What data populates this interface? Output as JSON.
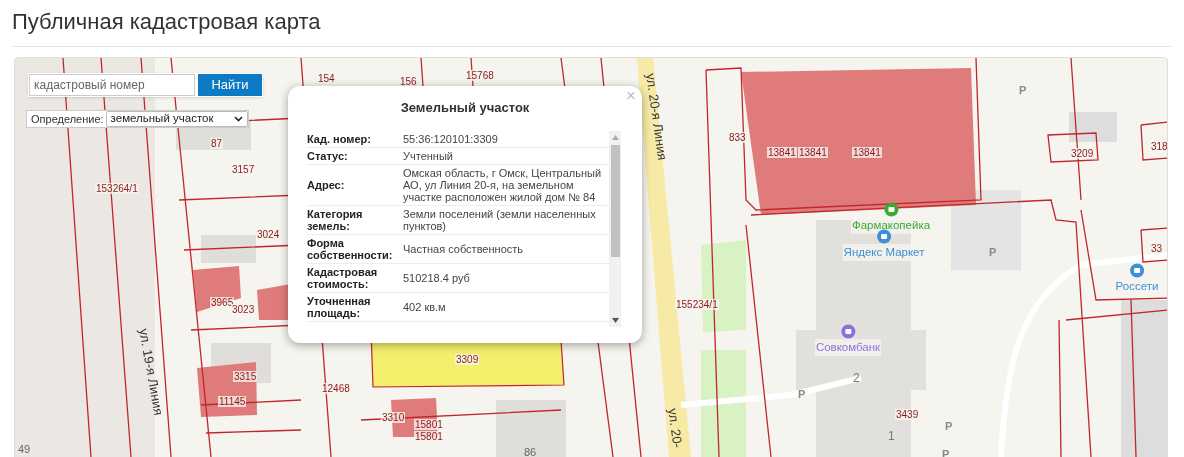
{
  "page_title": "Публичная кадастровая карта",
  "search": {
    "placeholder": "кадастровый номер",
    "button": "Найти"
  },
  "definition": {
    "label": "Определение:",
    "value": "земельный участок"
  },
  "map": {
    "labels": [
      {
        "kind": "parcel",
        "text": "154"
      },
      {
        "kind": "parcel",
        "text": "156"
      },
      {
        "kind": "parcel",
        "text": "15768"
      },
      {
        "kind": "parcel",
        "text": "87"
      },
      {
        "kind": "parcel",
        "text": "3157"
      },
      {
        "kind": "parcel",
        "text": "153264/1"
      },
      {
        "kind": "parcel",
        "text": "3024"
      },
      {
        "kind": "parcel",
        "text": "3965"
      },
      {
        "kind": "parcel",
        "text": "3023"
      },
      {
        "kind": "parcel",
        "text": "3315"
      },
      {
        "kind": "parcel",
        "text": "11145"
      },
      {
        "kind": "parcel",
        "text": "12468"
      },
      {
        "kind": "parcel",
        "text": "3309"
      },
      {
        "kind": "parcel",
        "text": "3310"
      },
      {
        "kind": "parcel",
        "text": "15801"
      },
      {
        "kind": "parcel",
        "text": "15801"
      },
      {
        "kind": "house",
        "text": "49"
      },
      {
        "kind": "house",
        "text": "86"
      },
      {
        "kind": "street",
        "text": "ул. 19-я Линия"
      },
      {
        "kind": "street",
        "text": "ул. 20-я Линия"
      },
      {
        "kind": "street",
        "text": "ул. 20-"
      },
      {
        "kind": "parcel",
        "text": "833"
      },
      {
        "kind": "parcel",
        "text": "13841"
      },
      {
        "kind": "parcel",
        "text": "13841"
      },
      {
        "kind": "parcel",
        "text": "13841"
      },
      {
        "kind": "parcel",
        "text": "3209"
      },
      {
        "kind": "parcel",
        "text": "318"
      },
      {
        "kind": "parcel",
        "text": "33"
      },
      {
        "kind": "parcel",
        "text": "155234/1"
      },
      {
        "kind": "poi",
        "text": "Фармакопейка",
        "color": "#3aa935"
      },
      {
        "kind": "poi",
        "text": "Яндекс Маркет",
        "color": "#3d8fd6"
      },
      {
        "kind": "poi",
        "text": "Россети",
        "color": "#3d8fd6"
      },
      {
        "kind": "poi",
        "text": "Совкомбанк",
        "color": "#8e6fe0"
      },
      {
        "kind": "parcel",
        "text": "3439"
      },
      {
        "kind": "parking",
        "text": "P"
      },
      {
        "kind": "parking",
        "text": "P"
      },
      {
        "kind": "parking",
        "text": "P"
      },
      {
        "kind": "parking",
        "text": "P"
      },
      {
        "kind": "parking",
        "text": "P"
      },
      {
        "kind": "entrance",
        "text": "2"
      },
      {
        "kind": "entrance",
        "text": "1"
      }
    ]
  },
  "popup": {
    "title": "Земельный участок",
    "close": "×",
    "rows": [
      {
        "label": "Кад. номер:",
        "value": "55:36:120101:3309"
      },
      {
        "label": "Статус:",
        "value": "Учтенный"
      },
      {
        "label": "Адрес:",
        "value": "Омская область, г Омск, Центральный АО, ул Линия 20-я, на земельном участке расположен жилой дом № 84"
      },
      {
        "label": "Категория земель:",
        "value": "Земли поселений (земли населенных пунктов)"
      },
      {
        "label": "Форма собственности:",
        "value": "Частная собственность"
      },
      {
        "label": "Кадастровая стоимость:",
        "value": "510218.4 руб"
      },
      {
        "label": "Уточненная площадь:",
        "value": "402 кв.м"
      }
    ]
  }
}
